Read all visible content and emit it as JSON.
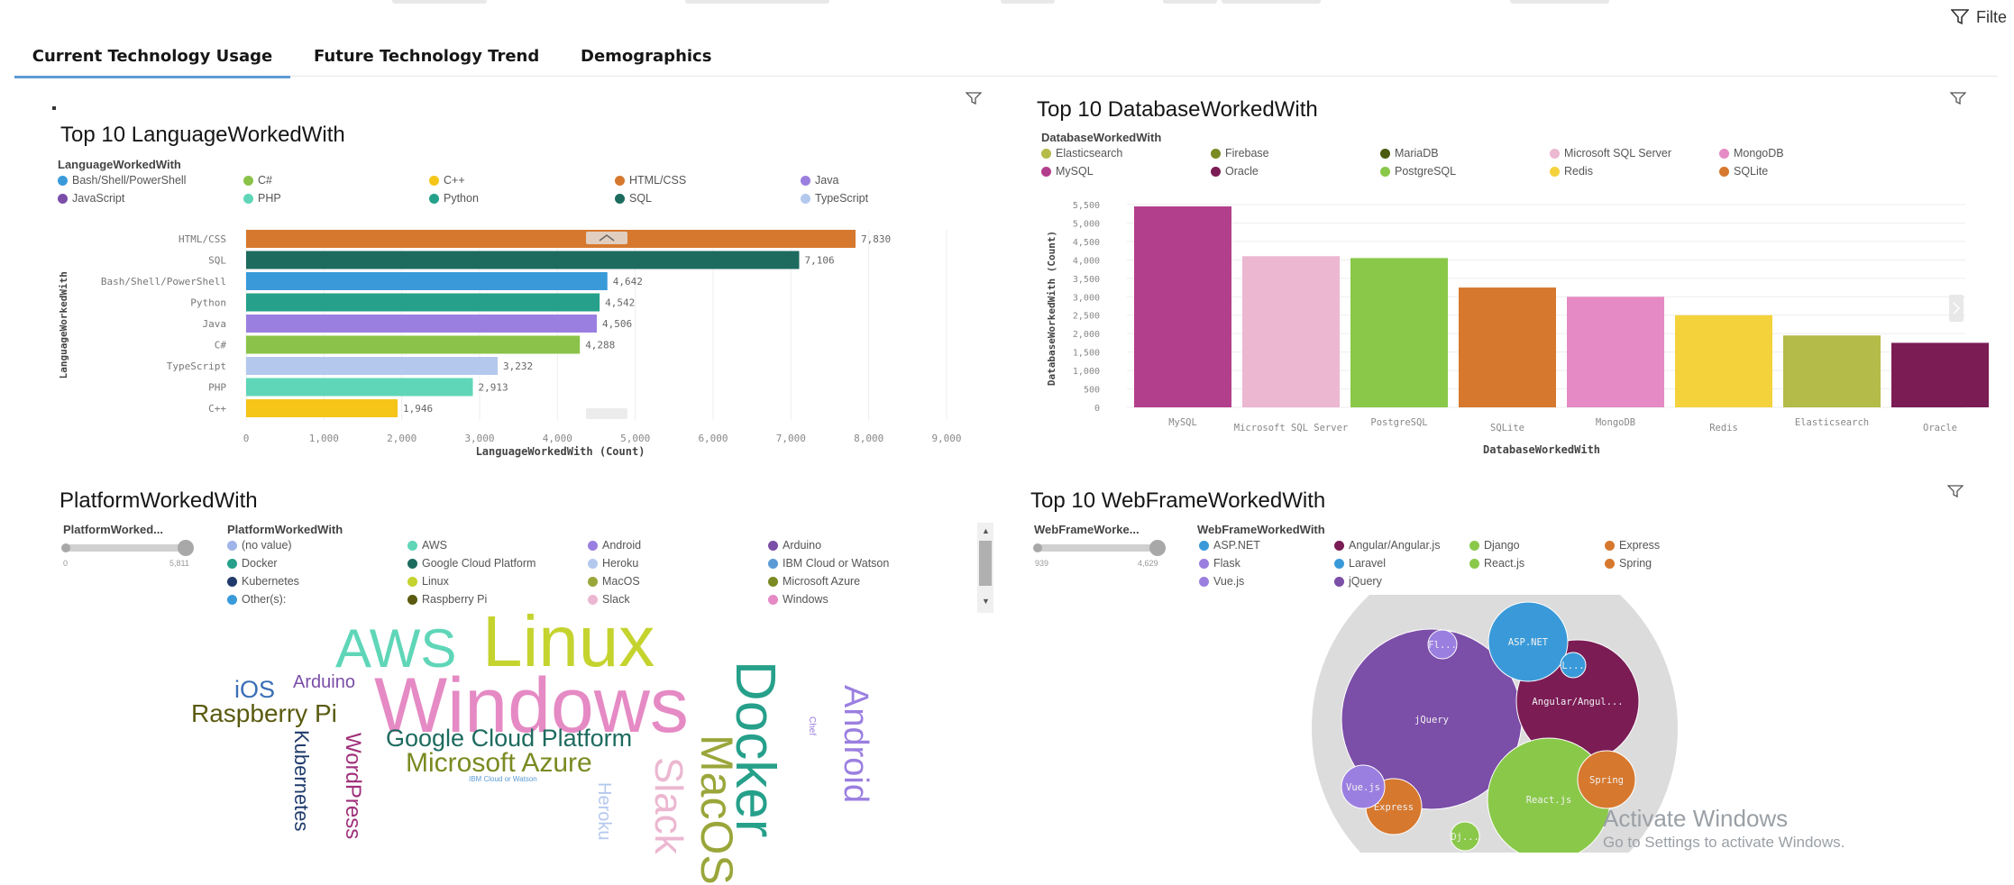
{
  "header": {
    "filter_label": "Filte",
    "tabs": [
      {
        "label": "Current Technology Usage"
      },
      {
        "label": "Future Technology Trend"
      },
      {
        "label": "Demographics"
      }
    ]
  },
  "lang_panel": {
    "title": "Top 10 LanguageWorkedWith",
    "legend_title": "LanguageWorkedWith",
    "legend": [
      {
        "label": "Bash/Shell/PowerShell",
        "color": "#3a9ad9"
      },
      {
        "label": "C#",
        "color": "#8bc34a"
      },
      {
        "label": "C++",
        "color": "#f5c518"
      },
      {
        "label": "HTML/CSS",
        "color": "#d6782e"
      },
      {
        "label": "Java",
        "color": "#9b7fe0"
      },
      {
        "label": "JavaScript",
        "color": "#7b4ea8"
      },
      {
        "label": "PHP",
        "color": "#5fd6b8"
      },
      {
        "label": "Python",
        "color": "#26a08a"
      },
      {
        "label": "SQL",
        "color": "#1d6b5f"
      },
      {
        "label": "TypeScript",
        "color": "#b4c8ee"
      }
    ]
  },
  "db_panel": {
    "title": "Top 10 DatabaseWorkedWith",
    "legend_title": "DatabaseWorkedWith",
    "legend": [
      {
        "label": "Elasticsearch",
        "color": "#b4bb48"
      },
      {
        "label": "Firebase",
        "color": "#7b8a22"
      },
      {
        "label": "MariaDB",
        "color": "#4a5a10"
      },
      {
        "label": "Microsoft SQL Server",
        "color": "#ecb7d1"
      },
      {
        "label": "MongoDB",
        "color": "#e58ac4"
      },
      {
        "label": "MySQL",
        "color": "#b23f8c"
      },
      {
        "label": "Oracle",
        "color": "#7b1c55"
      },
      {
        "label": "PostgreSQL",
        "color": "#8ac84a"
      },
      {
        "label": "Redis",
        "color": "#f4d23c"
      },
      {
        "label": "SQLite",
        "color": "#d6782e"
      }
    ]
  },
  "platform_panel": {
    "title": "PlatformWorkedWith",
    "slider_label": "PlatformWorked...",
    "slider_min": "0",
    "slider_max": "5,811",
    "legend_title": "PlatformWorkedWith",
    "legend": [
      {
        "label": "(no value)",
        "color": "#9fb4e8"
      },
      {
        "label": "AWS",
        "color": "#5fd6b8"
      },
      {
        "label": "Android",
        "color": "#9b7fe0"
      },
      {
        "label": "Arduino",
        "color": "#7b4ea8"
      },
      {
        "label": "Docker",
        "color": "#26a08a"
      },
      {
        "label": "Google Cloud Platform",
        "color": "#1d6b5f"
      },
      {
        "label": "Heroku",
        "color": "#b4c8ee"
      },
      {
        "label": "IBM Cloud or Watson",
        "color": "#5b9bd5"
      },
      {
        "label": "Kubernetes",
        "color": "#1f3a6b"
      },
      {
        "label": "Linux",
        "color": "#c5d32e"
      },
      {
        "label": "MacOS",
        "color": "#9aa63a"
      },
      {
        "label": "Microsoft Azure",
        "color": "#7b8a22"
      },
      {
        "label": "Other(s):",
        "color": "#3a9ad9"
      },
      {
        "label": "Raspberry Pi",
        "color": "#5a5a10"
      },
      {
        "label": "Slack",
        "color": "#ecb7d1"
      },
      {
        "label": "Windows",
        "color": "#e58ac4"
      }
    ],
    "words": [
      {
        "text": "AWS",
        "color": "#5fd6b8"
      },
      {
        "text": "Linux",
        "color": "#c5d32e"
      },
      {
        "text": "Windows",
        "color": "#e58ac4"
      },
      {
        "text": "Docker",
        "color": "#26a08a"
      },
      {
        "text": "Android",
        "color": "#9b7fe0"
      },
      {
        "text": "iOS",
        "color": "#3a6fb5"
      },
      {
        "text": "Arduino",
        "color": "#7b4ea8"
      },
      {
        "text": "Raspberry Pi",
        "color": "#5a5a10"
      },
      {
        "text": "Google Cloud Platform",
        "color": "#1d6b5f"
      },
      {
        "text": "Microsoft Azure",
        "color": "#7b8a22"
      },
      {
        "text": "IBM Cloud or Watson",
        "color": "#5b9bd5"
      },
      {
        "text": "Kubernetes",
        "color": "#1f3a6b"
      },
      {
        "text": "WordPress",
        "color": "#a0307a"
      },
      {
        "text": "Heroku",
        "color": "#b4c8ee"
      },
      {
        "text": "Slack",
        "color": "#ecb7d1"
      },
      {
        "text": "MacOS",
        "color": "#9aa63a"
      },
      {
        "text": "Chef",
        "color": "#9b7fe0"
      }
    ]
  },
  "web_panel": {
    "title": "Top 10 WebFrameWorkedWith",
    "slider_label": "WebFrameWorke...",
    "slider_min": "939",
    "slider_max": "4,629",
    "legend_title": "WebFrameWorkedWith",
    "legend": [
      {
        "label": "ASP.NET",
        "color": "#3a9ad9"
      },
      {
        "label": "Angular/Angular.js",
        "color": "#7b1c55"
      },
      {
        "label": "Django",
        "color": "#8ac84a"
      },
      {
        "label": "Express",
        "color": "#d6782e"
      },
      {
        "label": "Flask",
        "color": "#9b7fe0"
      },
      {
        "label": "Laravel",
        "color": "#3a9ad9"
      },
      {
        "label": "React.js",
        "color": "#8ac84a"
      },
      {
        "label": "Spring",
        "color": "#d6782e"
      },
      {
        "label": "Vue.js",
        "color": "#9b7fe0"
      },
      {
        "label": "jQuery",
        "color": "#7b4ea8"
      }
    ]
  },
  "watermark": {
    "line1": "Activate Windows",
    "line2": "Go to Settings to activate Windows."
  },
  "chart_data": [
    {
      "type": "bar",
      "orientation": "horizontal",
      "title": "Top 10 LanguageWorkedWith",
      "xlabel": "LanguageWorkedWith (Count)",
      "ylabel": "LanguageWorkedWith",
      "categories": [
        "HTML/CSS",
        "SQL",
        "Bash/Shell/PowerShell",
        "Python",
        "Java",
        "C#",
        "TypeScript",
        "PHP",
        "C++"
      ],
      "values": [
        7830,
        7106,
        4642,
        4542,
        4506,
        4288,
        3232,
        2913,
        1946
      ],
      "value_labels": [
        "7,830",
        "7,106",
        "4,642",
        "4,542",
        "4,506",
        "4,288",
        "3,232",
        "2,913",
        "1,946"
      ],
      "colors": [
        "#d6782e",
        "#1d6b5f",
        "#3a9ad9",
        "#26a08a",
        "#9b7fe0",
        "#8bc34a",
        "#b4c8ee",
        "#5fd6b8",
        "#f5c518"
      ],
      "xticks": [
        "0",
        "1,000",
        "2,000",
        "3,000",
        "4,000",
        "5,000",
        "6,000",
        "7,000",
        "8,000",
        "9,000"
      ],
      "xlim": [
        0,
        9000
      ]
    },
    {
      "type": "bar",
      "title": "Top 10 DatabaseWorkedWith",
      "xlabel": "DatabaseWorkedWith",
      "ylabel": "DatabaseWorkedWith (Count)",
      "categories": [
        "MySQL",
        "Microsoft SQL Server",
        "PostgreSQL",
        "SQLite",
        "MongoDB",
        "Redis",
        "Elasticsearch",
        "Oracle"
      ],
      "values": [
        5450,
        4100,
        4050,
        3250,
        3000,
        2500,
        1950,
        1750
      ],
      "colors": [
        "#b23f8c",
        "#ecb7d1",
        "#8ac84a",
        "#d6782e",
        "#e58ac4",
        "#f4d23c",
        "#b4bb48",
        "#7b1c55"
      ],
      "yticks": [
        "0",
        "500",
        "1,000",
        "1,500",
        "2,000",
        "2,500",
        "3,000",
        "3,500",
        "4,000",
        "4,500",
        "5,000",
        "5,500"
      ],
      "ylim": [
        0,
        5500
      ]
    },
    {
      "type": "other",
      "subtype": "bubble",
      "title": "Top 10 WebFrameWorkedWith",
      "labels": [
        "jQuery",
        "Angular/Angul...",
        "ASP.NET",
        "React.js",
        "Express",
        "Vue.js",
        "Spring",
        "Fl...",
        "L...",
        "Dj..."
      ],
      "colors": [
        "#7b4ea8",
        "#7b1c55",
        "#3a9ad9",
        "#8ac84a",
        "#d6782e",
        "#9b7fe0",
        "#d6782e",
        "#9b7fe0",
        "#3a9ad9",
        "#8ac84a"
      ],
      "relative_size": [
        4629,
        2800,
        2400,
        2700,
        1200,
        1000,
        1100,
        600,
        500,
        939
      ]
    }
  ]
}
